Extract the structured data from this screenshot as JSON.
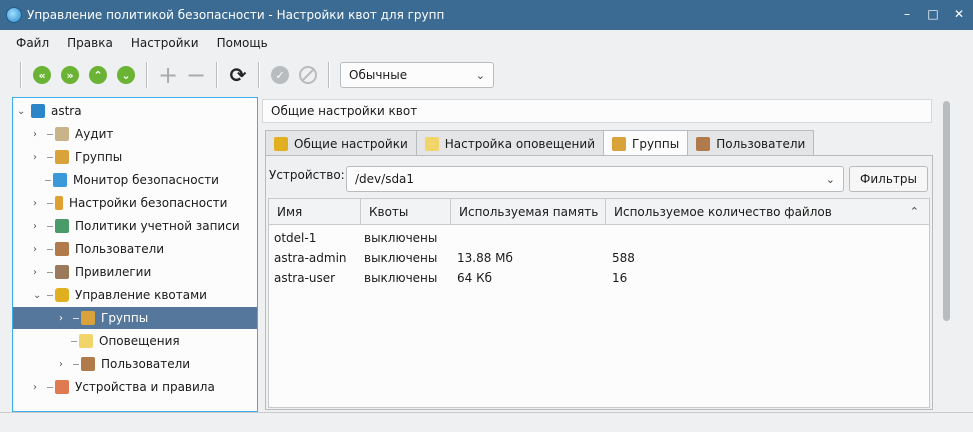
{
  "window": {
    "title": "Управление политикой безопасности - Настройки квот для групп"
  },
  "menu": [
    "Файл",
    "Правка",
    "Настройки",
    "Помощь"
  ],
  "toolbar": {
    "mode_value": "Обычные"
  },
  "tree": {
    "root": "astra",
    "items": [
      "Аудит",
      "Группы",
      "Монитор безопасности",
      "Настройки безопасности",
      "Политики учетной записи",
      "Пользователи",
      "Привилегии",
      "Управление квотами",
      "Группы",
      "Оповещения",
      "Пользователи",
      "Устройства и правила"
    ]
  },
  "panel": {
    "header": "Общие настройки квот",
    "tabs": [
      "Общие настройки",
      "Настройка оповещений",
      "Группы",
      "Пользователи"
    ],
    "device_label": "Устройство:",
    "device_value": "/dev/sda1",
    "filters_label": "Фильтры"
  },
  "table": {
    "columns": [
      "Имя",
      "Квоты",
      "Используемая память",
      "Используемое количество файлов"
    ],
    "rows": [
      [
        "otdel-1",
        "выключены",
        "",
        ""
      ],
      [
        "astra-admin",
        "выключены",
        "13.88 Мб",
        "588"
      ],
      [
        "astra-user",
        "выключены",
        "64 Кб",
        "16"
      ]
    ]
  }
}
